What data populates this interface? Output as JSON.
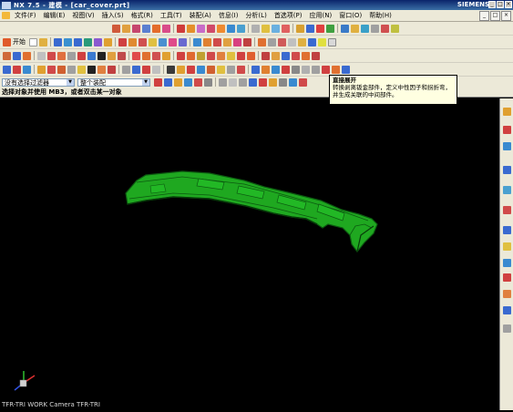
{
  "titlebar": {
    "title": "NX 7.5 - 建模 - [car_cover.prt]",
    "brand": "SIEMENS",
    "minimize": "_",
    "restore": "□",
    "close": "×"
  },
  "menu": {
    "items": [
      "文件(F)",
      "编辑(E)",
      "视图(V)",
      "插入(S)",
      "格式(R)",
      "工具(T)",
      "装配(A)",
      "信息(I)",
      "分析(L)",
      "首选项(P)",
      "应用(N)",
      "窗口(O)",
      "帮助(H)"
    ]
  },
  "toolbar": {
    "start_label": "开始"
  },
  "selection": {
    "filter": "没有选择过滤器",
    "scope": "整个装配"
  },
  "cue_line": "选择对象并使用 MB3，或者双击某一对象",
  "tooltip": {
    "title": "直接展开",
    "body": "转换剥离钣金部件，定义中性因子和拐折弯，并生成关联的中间部件。"
  },
  "viewport": {
    "view_label": "TFR-TRI WORK Camera TFR-TRI",
    "background": "#000000",
    "model_color": "#1fa820"
  }
}
